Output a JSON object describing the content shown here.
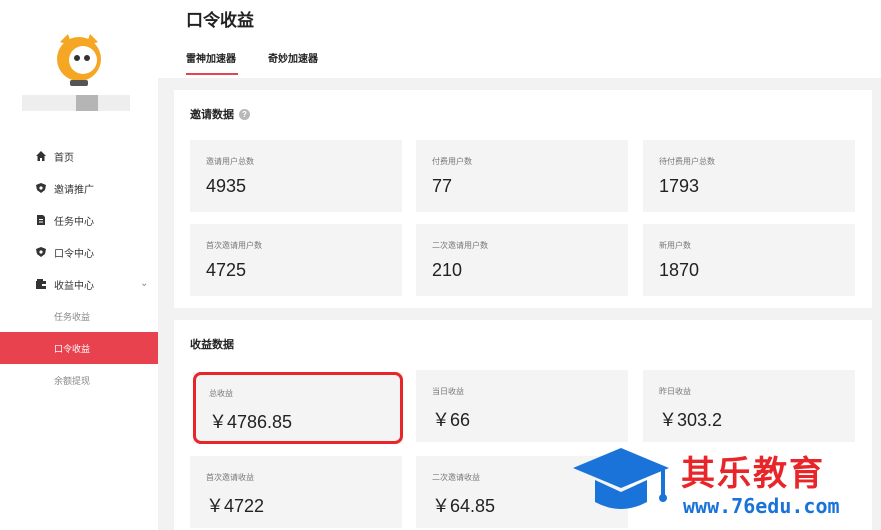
{
  "sidebar": {
    "nav": [
      {
        "label": "首页",
        "icon": "home-icon"
      },
      {
        "label": "邀请推广",
        "icon": "shield-icon"
      },
      {
        "label": "任务中心",
        "icon": "document-icon"
      },
      {
        "label": "口令中心",
        "icon": "shield-icon"
      },
      {
        "label": "收益中心",
        "icon": "wallet-icon"
      }
    ],
    "sub": [
      {
        "label": "任务收益"
      },
      {
        "label": "口令收益"
      },
      {
        "label": "余额提现"
      }
    ]
  },
  "header": {
    "title": "口令收益",
    "tabs": [
      {
        "label": "雷神加速器"
      },
      {
        "label": "奇妙加速器"
      }
    ]
  },
  "invite": {
    "title": "邀请数据",
    "stats": [
      {
        "label": "邀请用户总数",
        "value": "4935"
      },
      {
        "label": "付费用户数",
        "value": "77"
      },
      {
        "label": "待付费用户总数",
        "value": "1793"
      },
      {
        "label": "首次邀请用户数",
        "value": "4725"
      },
      {
        "label": "二次邀请用户数",
        "value": "210"
      },
      {
        "label": "新用户数",
        "value": "1870"
      }
    ]
  },
  "income": {
    "title": "收益数据",
    "stats": [
      {
        "label": "总收益",
        "value": "￥4786.85"
      },
      {
        "label": "当日收益",
        "value": "￥66"
      },
      {
        "label": "昨日收益",
        "value": "￥303.2"
      },
      {
        "label": "首次邀请收益",
        "value": "￥4722"
      },
      {
        "label": "二次邀请收益",
        "value": "￥64.85"
      }
    ]
  },
  "watermark": {
    "brand": "其乐教育",
    "url": "www.76edu.com"
  },
  "colors": {
    "accent": "#e8424f",
    "highlight_border": "#e8262a",
    "watermark_blue": "#1a73d9"
  }
}
